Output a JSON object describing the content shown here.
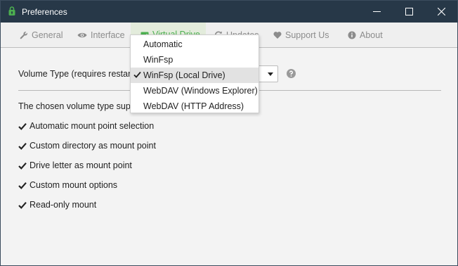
{
  "window": {
    "title": "Preferences"
  },
  "tabs": [
    {
      "label": "General",
      "icon": "wrench-icon",
      "active": false
    },
    {
      "label": "Interface",
      "icon": "eye-icon",
      "active": false
    },
    {
      "label": "Virtual Drive",
      "icon": "drive-icon",
      "active": true
    },
    {
      "label": "Updates",
      "icon": "refresh-icon",
      "active": false
    },
    {
      "label": "Support Us",
      "icon": "heart-icon",
      "active": false
    },
    {
      "label": "About",
      "icon": "info-icon",
      "active": false
    }
  ],
  "volume": {
    "label": "Volume Type (requires restart)",
    "selected": "WinFsp (Local Drive)",
    "options": [
      "Automatic",
      "WinFsp",
      "WinFsp (Local Drive)",
      "WebDAV (Windows Explorer)",
      "WebDAV (HTTP Address)"
    ]
  },
  "supports": {
    "intro": "The chosen volume type supports:",
    "features": [
      "Automatic mount point selection",
      "Custom directory as mount point",
      "Drive letter as mount point",
      "Custom mount options",
      "Read-only mount"
    ]
  },
  "colors": {
    "titlebar": "#273848",
    "accent": "#4caf50",
    "tab_inactive": "#8c8c8c",
    "selected_item": "#e2e2e2"
  }
}
